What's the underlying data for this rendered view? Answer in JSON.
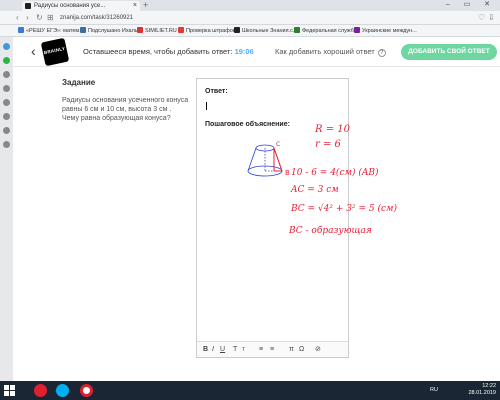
{
  "browser": {
    "tab_title": "Радиусы основания усе...",
    "url": "znanija.com/task/31260921",
    "bookmarks": [
      "«РЕШУ ЕГЭ»: матем...",
      "Подслушано Ихалы",
      "SIMILIET.RU",
      "Проверка штрафов...",
      "Школьные Знания.c...",
      "Федеральная служб...",
      "Украинские междун..."
    ]
  },
  "header": {
    "logo_text": "BRAINLY",
    "timer_label": "Оставшееся время, чтобы добавить ответ:",
    "timer_value": "19:06",
    "good_answer_label": "Как добавить хороший ответ",
    "add_answer_button": "ДОБАВИТЬ СВОЙ ОТВЕТ"
  },
  "task": {
    "title": "Задание",
    "text": "Радиусы основания усеченного конуса равны 6 см и 10 см, высота 3 см . Чему равна образующая конуса?"
  },
  "editor": {
    "answer_label": "Ответ:",
    "explanation_label": "Пошаговое объяснение:",
    "handwriting": {
      "line1": "R = 10",
      "line2": "r = 6",
      "line3": "10 - 6 = 4(см) (AB)",
      "line4": "AC = 3 см",
      "line5a": "BC = √4² + 3² = 5 (см)",
      "line6": "BC - образующая",
      "lbl_c": "C",
      "lbl_b": "B"
    },
    "toolbar": {
      "bold": "B",
      "italic": "I",
      "underline": "U",
      "superscript": "T",
      "subscript": "T",
      "list_ul": "≡",
      "list_ol": "≡",
      "pi": "π",
      "omega": "Ω",
      "attach": "⊘"
    }
  },
  "taskbar": {
    "lang": "RU",
    "time": "12:22",
    "date": "28.01.2019"
  },
  "colors": {
    "accent_blue": "#4fb3f6",
    "add_button": "#6ed6a0",
    "handwriting": "#e8213a",
    "drawing_blue": "#2a3fd6"
  }
}
